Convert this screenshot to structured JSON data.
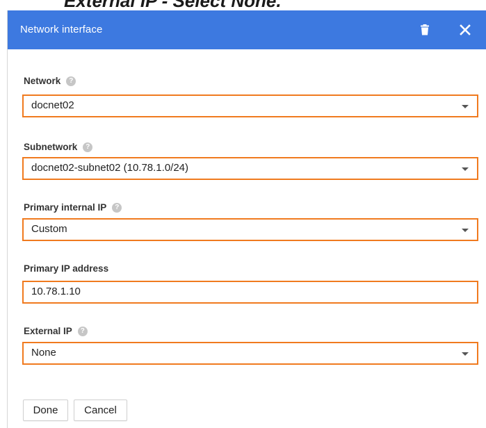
{
  "caption": "External IP - Select None.",
  "dialog": {
    "title": "Network interface",
    "icons": {
      "delete": "trash-icon",
      "close": "close-icon"
    }
  },
  "fields": {
    "network": {
      "label": "Network",
      "value": "docnet02"
    },
    "subnetwork": {
      "label": "Subnetwork",
      "value": "docnet02-subnet02 (10.78.1.0/24)"
    },
    "primary_internal_ip": {
      "label": "Primary internal IP",
      "value": "Custom"
    },
    "primary_ip_address": {
      "label": "Primary IP address",
      "value": "10.78.1.10"
    },
    "external_ip": {
      "label": "External IP",
      "value": "None"
    }
  },
  "help_glyph": "?",
  "buttons": {
    "done": "Done",
    "cancel": "Cancel"
  },
  "colors": {
    "header": "#3d79e0",
    "highlight": "#f07a1e",
    "help_icon": "#c6c6c6"
  }
}
